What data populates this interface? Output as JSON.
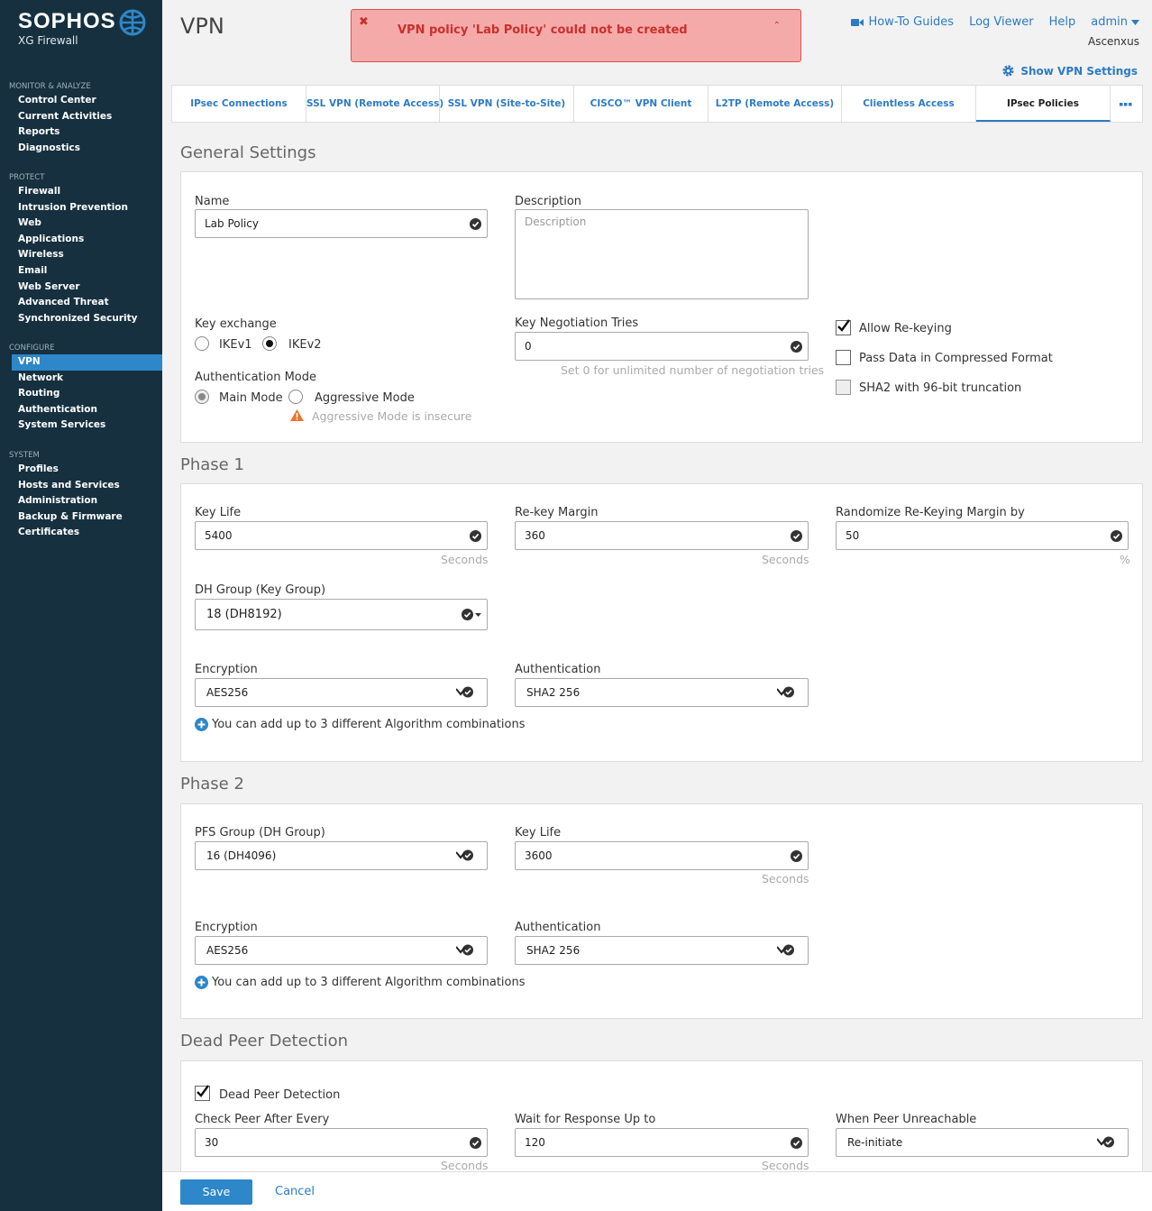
{
  "brand": {
    "logo": "SOPHOS",
    "product": "XG Firewall"
  },
  "sidebar": {
    "sections": [
      {
        "heading": "MONITOR & ANALYZE",
        "items": [
          "Control Center",
          "Current Activities",
          "Reports",
          "Diagnostics"
        ]
      },
      {
        "heading": "PROTECT",
        "items": [
          "Firewall",
          "Intrusion Prevention",
          "Web",
          "Applications",
          "Wireless",
          "Email",
          "Web Server",
          "Advanced Threat",
          "Synchronized Security"
        ]
      },
      {
        "heading": "CONFIGURE",
        "items": [
          "VPN",
          "Network",
          "Routing",
          "Authentication",
          "System Services"
        ]
      },
      {
        "heading": "SYSTEM",
        "items": [
          "Profiles",
          "Hosts and Services",
          "Administration",
          "Backup & Firmware",
          "Certificates"
        ]
      }
    ],
    "active": "VPN"
  },
  "header": {
    "title": "VPN",
    "alert": "VPN policy 'Lab Policy' could not be created",
    "links": {
      "howto": "How-To Guides",
      "logviewer": "Log Viewer",
      "help": "Help",
      "admin": "admin"
    },
    "org": "Ascenxus",
    "vpn_settings": "Show VPN Settings"
  },
  "tabs": [
    "IPsec Connections",
    "SSL VPN (Remote Access)",
    "SSL VPN (Site-to-Site)",
    "CISCO™ VPN Client",
    "L2TP (Remote Access)",
    "Clientless Access",
    "IPsec Policies"
  ],
  "active_tab": "IPsec Policies",
  "general": {
    "title": "General Settings",
    "name_label": "Name",
    "name_value": "Lab Policy",
    "desc_label": "Description",
    "desc_placeholder": "Description",
    "keyex_label": "Key exchange",
    "ikev1": "IKEv1",
    "ikev2": "IKEv2",
    "keyex_selected": "IKEv2",
    "tries_label": "Key Negotiation Tries",
    "tries_value": "0",
    "tries_hint": "Set 0 for unlimited number of negotiation tries",
    "authmode_label": "Authentication Mode",
    "main_mode": "Main Mode",
    "aggressive_mode": "Aggressive Mode",
    "authmode_selected": "Main Mode",
    "aggressive_warning": "Aggressive Mode is insecure",
    "allow_rekey": "Allow Re-keying",
    "allow_rekey_checked": true,
    "compressed": "Pass Data in Compressed Format",
    "compressed_checked": false,
    "sha2_trunc": "SHA2 with 96-bit truncation",
    "sha2_trunc_checked": false
  },
  "phase1": {
    "title": "Phase 1",
    "keylife_label": "Key Life",
    "keylife_value": "5400",
    "keylife_unit": "Seconds",
    "rekey_label": "Re-key Margin",
    "rekey_value": "360",
    "rekey_unit": "Seconds",
    "random_label": "Randomize Re-Keying Margin by",
    "random_value": "50",
    "random_unit": "%",
    "dh_label": "DH Group (Key Group)",
    "dh_value": "18 (DH8192)",
    "enc_label": "Encryption",
    "enc_value": "AES256",
    "auth_label": "Authentication",
    "auth_value": "SHA2 256",
    "add_note": "You can add up to 3 different Algorithm combinations"
  },
  "phase2": {
    "title": "Phase 2",
    "pfs_label": "PFS Group (DH Group)",
    "pfs_value": "16 (DH4096)",
    "keylife_label": "Key Life",
    "keylife_value": "3600",
    "keylife_unit": "Seconds",
    "enc_label": "Encryption",
    "enc_value": "AES256",
    "auth_label": "Authentication",
    "auth_value": "SHA2 256",
    "add_note": "You can add up to 3 different Algorithm combinations"
  },
  "dpd": {
    "title": "Dead Peer Detection",
    "enable_label": "Dead Peer Detection",
    "enabled": true,
    "check_label": "Check Peer After Every",
    "check_value": "30",
    "check_unit": "Seconds",
    "wait_label": "Wait for Response Up to",
    "wait_value": "120",
    "wait_unit": "Seconds",
    "unreach_label": "When Peer Unreachable",
    "unreach_value": "Re-initiate"
  },
  "footer": {
    "save": "Save",
    "cancel": "Cancel"
  }
}
